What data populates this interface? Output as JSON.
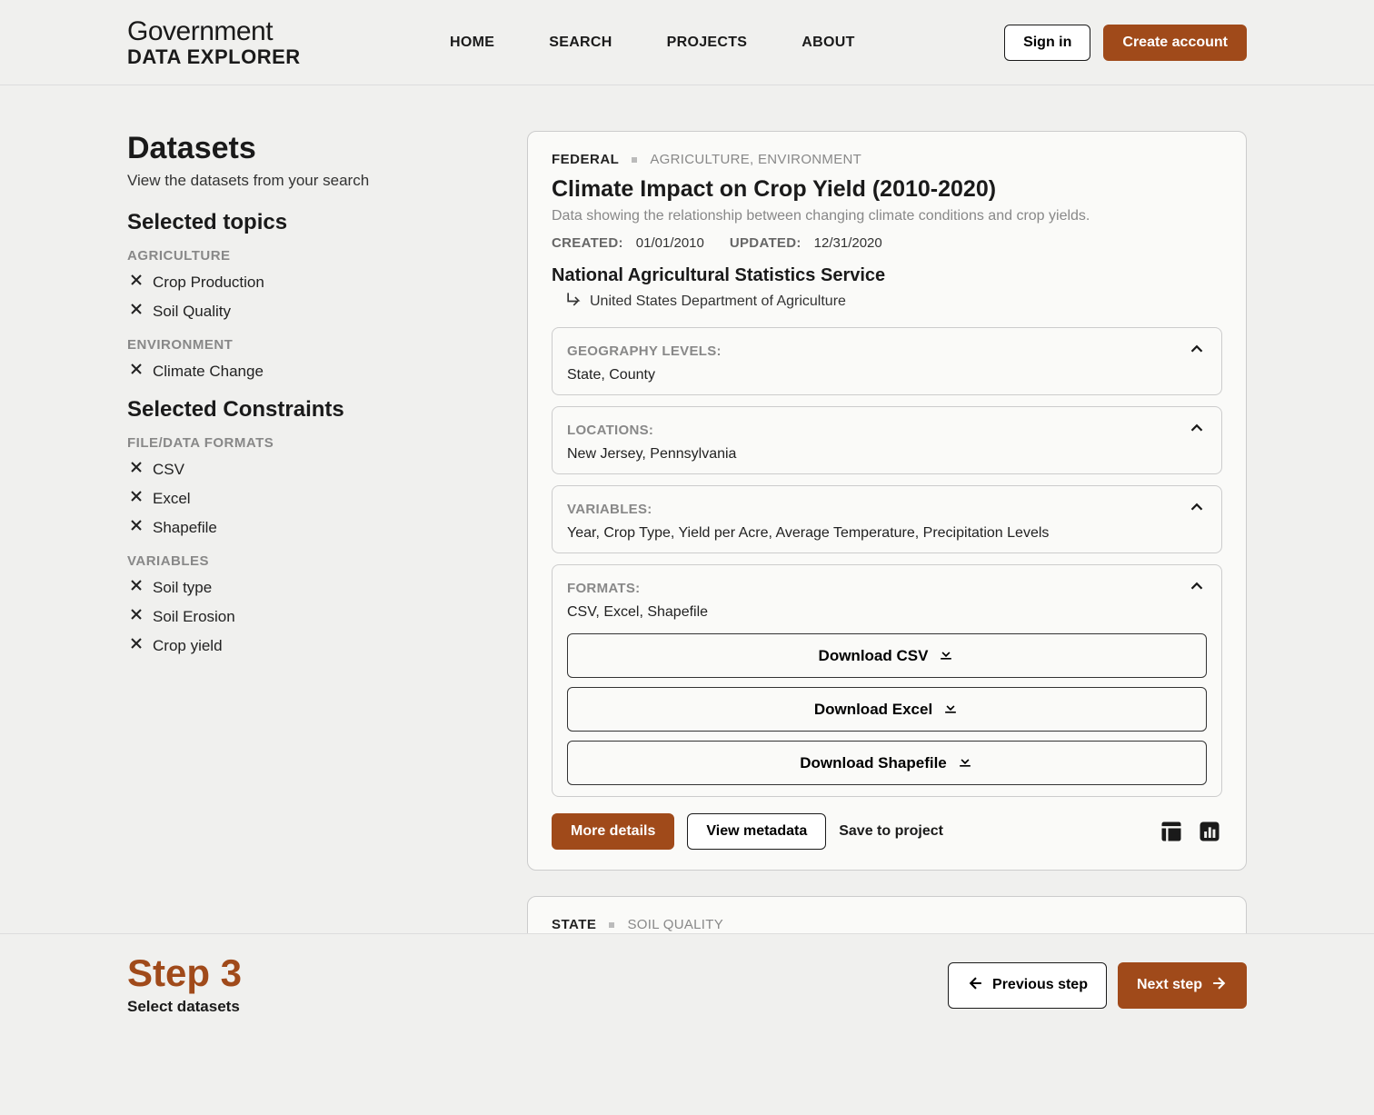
{
  "brand": {
    "top": "Government",
    "bottom": "DATA EXPLORER"
  },
  "nav": {
    "home": "HOME",
    "search": "SEARCH",
    "projects": "PROJECTS",
    "about": "ABOUT"
  },
  "auth": {
    "sign_in": "Sign in",
    "create": "Create account"
  },
  "sidebar": {
    "title": "Datasets",
    "subtitle": "View the datasets from your search",
    "topics_heading": "Selected topics",
    "constraints_heading": "Selected Constraints",
    "group_agriculture": "AGRICULTURE",
    "topic_crop_production": "Crop Production",
    "topic_soil_quality": "Soil Quality",
    "group_environment": "ENVIRONMENT",
    "topic_climate_change": "Climate Change",
    "group_formats": "FILE/DATA FORMATS",
    "fmt_csv": "CSV",
    "fmt_excel": "Excel",
    "fmt_shapefile": "Shapefile",
    "group_variables": "VARIABLES",
    "var_soil_type": "Soil type",
    "var_soil_erosion": "Soil Erosion",
    "var_crop_yield": "Crop yield"
  },
  "card1": {
    "level": "FEDERAL",
    "categories": "AGRICULTURE, ENVIRONMENT",
    "title": "Climate Impact on Crop Yield (2010-2020)",
    "desc": "Data showing the relationship between changing climate conditions and crop yields.",
    "created_k": "CREATED:",
    "created_v": "01/01/2010",
    "updated_k": "UPDATED:",
    "updated_v": "12/31/2020",
    "source": "National Agricultural Statistics Service",
    "parent": "United States Department of Agriculture",
    "geo_label": "GEOGRAPHY LEVELS:",
    "geo_value": "State, County",
    "loc_label": "LOCATIONS:",
    "loc_value": "New Jersey, Pennsylvania",
    "var_label": "VARIABLES:",
    "var_value": "Year, Crop Type, Yield per Acre, Average Temperature, Precipitation Levels",
    "fmt_label": "FORMATS:",
    "fmt_value": "CSV, Excel, Shapefile",
    "dl_csv": "Download CSV",
    "dl_excel": "Download Excel",
    "dl_shapefile": "Download Shapefile",
    "more": "More details",
    "metadata": "View metadata",
    "save": "Save to project"
  },
  "card2": {
    "level": "STATE",
    "categories": "SOIL QUALITY"
  },
  "footer": {
    "step": "Step 3",
    "sub": "Select datasets",
    "prev": "Previous step",
    "next": "Next step"
  }
}
